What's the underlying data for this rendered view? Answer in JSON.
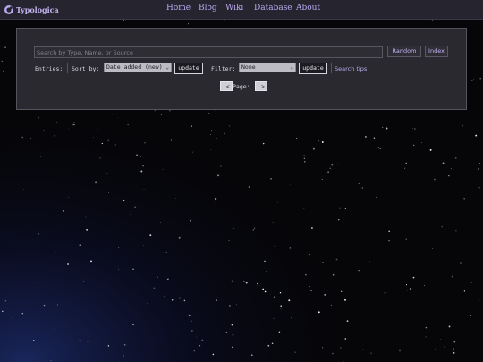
{
  "header": {
    "brand": "Typologica",
    "nav": [
      "Home",
      "Blog",
      "Wiki",
      "Database",
      "About"
    ]
  },
  "search": {
    "placeholder": "Search by Type, Name, or Source",
    "value": ""
  },
  "buttons": {
    "random": "Random",
    "index": "Index"
  },
  "controls": {
    "entries_label": "Entries:",
    "sort_label": "Sort by:",
    "sort_value": "Date added (new)",
    "update_label": "update",
    "filter_label": "Filter:",
    "filter_value": "None",
    "search_tips": "Search tips"
  },
  "pager": {
    "prev": "<",
    "label": "Page:",
    "next": ">"
  },
  "colors": {
    "accent": "#b9a8f0",
    "panel": "#2a2930",
    "header": "#26242f"
  }
}
